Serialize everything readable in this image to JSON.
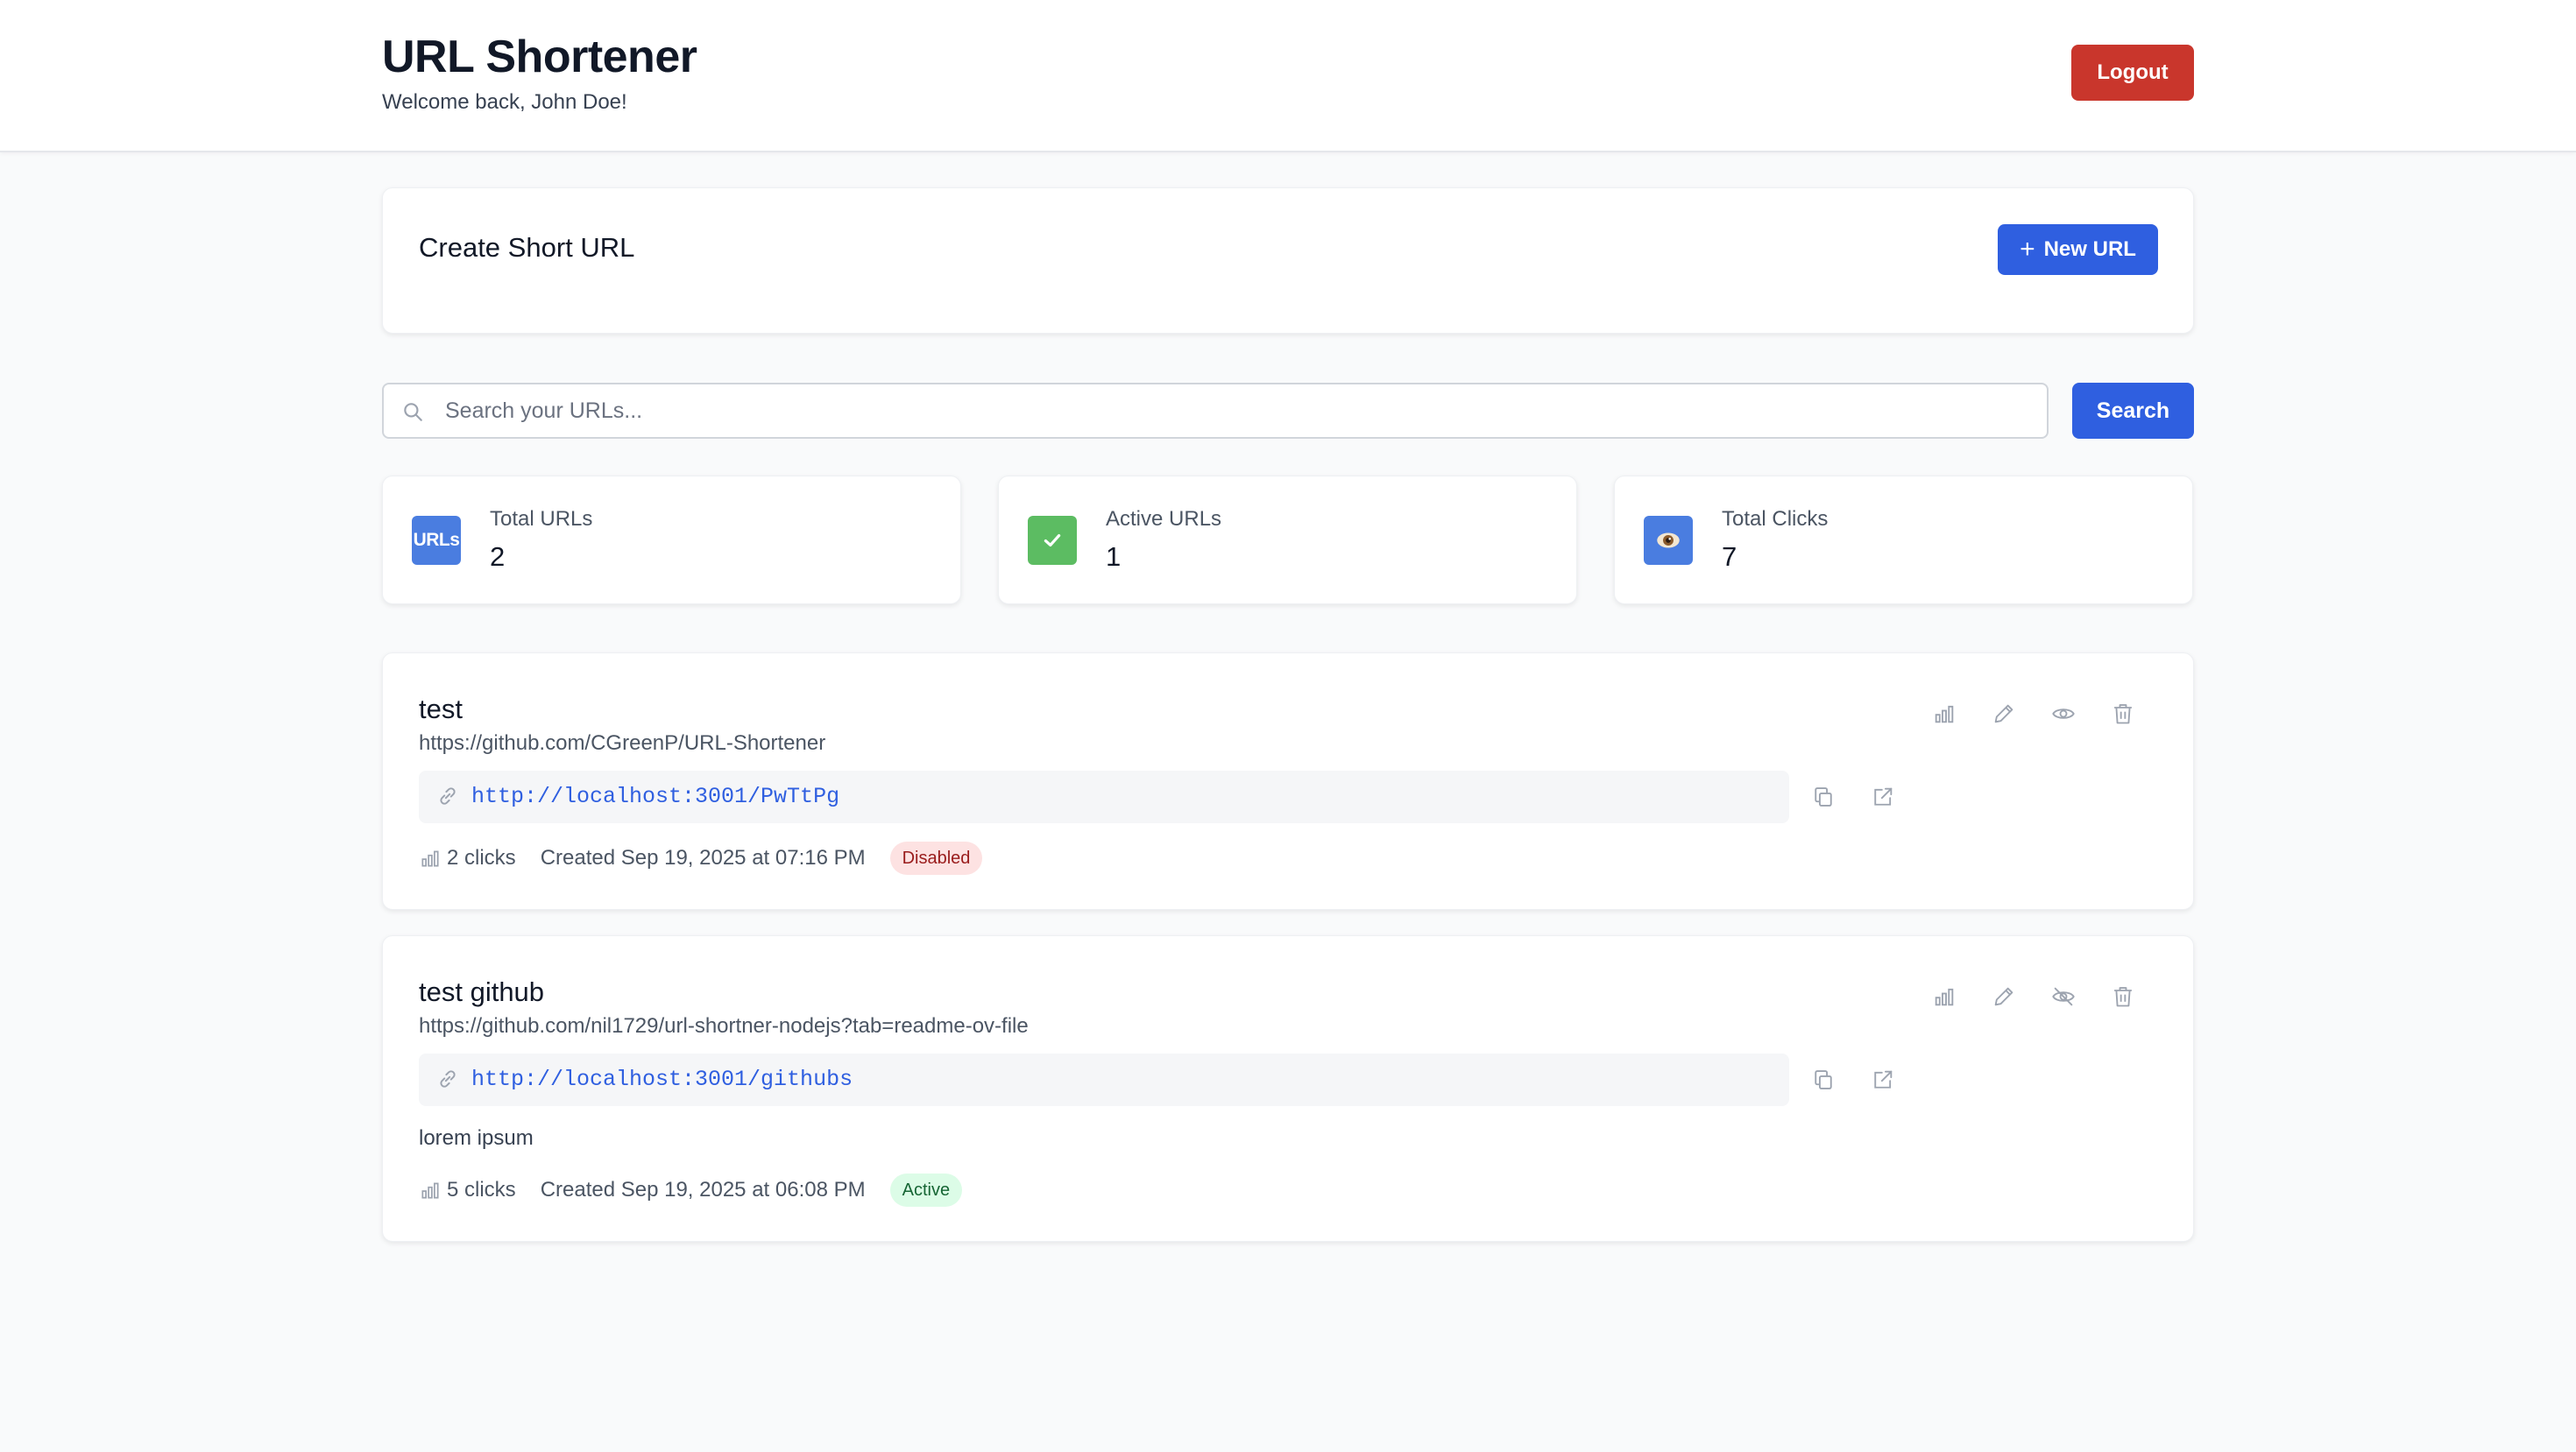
{
  "header": {
    "title": "URL Shortener",
    "welcome": "Welcome back, John Doe!",
    "logout_label": "Logout"
  },
  "create": {
    "title": "Create Short URL",
    "new_url_label": "New URL",
    "new_url_icon": "plus-icon"
  },
  "search": {
    "placeholder": "Search your URLs...",
    "value": "",
    "button_label": "Search",
    "icon": "search-icon"
  },
  "stats": [
    {
      "label": "Total URLs",
      "value": "2",
      "icon_text": "URLs",
      "icon_color": "#4a7de0"
    },
    {
      "label": "Active URLs",
      "value": "1",
      "icon": "check-icon",
      "icon_color": "#5cbc62"
    },
    {
      "label": "Total Clicks",
      "value": "7",
      "icon": "eye-icon",
      "icon_color": "#4a7de0"
    }
  ],
  "urls": [
    {
      "name": "test",
      "original": "https://github.com/CGreenP/URL-Shortener",
      "short": "http://localhost:3001/PwTtPg",
      "description": "",
      "clicks": "2 clicks",
      "created": "Created Sep 19, 2025 at 07:16 PM",
      "status": "Disabled",
      "status_color": "#fde2e2"
    },
    {
      "name": "test github",
      "original": "https://github.com/nil1729/url-shortner-nodejs?tab=readme-ov-file",
      "short": "http://localhost:3001/githubs",
      "description": "lorem ipsum",
      "clicks": "5 clicks",
      "created": "Created Sep 19, 2025 at 06:08 PM",
      "status": "Active",
      "status_color": "#dcfce7"
    }
  ],
  "colors": {
    "primary": "#2f5fe0",
    "danger": "#c9362c",
    "background": "#f9fafb"
  }
}
